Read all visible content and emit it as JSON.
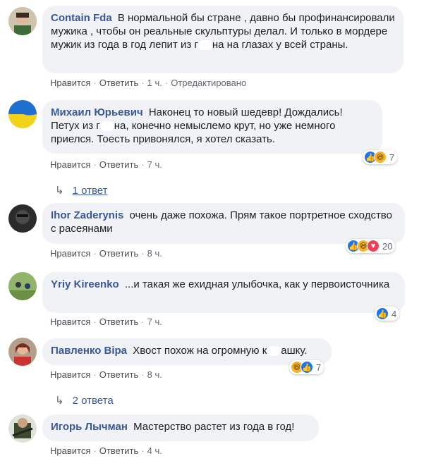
{
  "actions": {
    "like": "Нравится",
    "reply": "Ответить",
    "separator": "·"
  },
  "comments": [
    {
      "author": "Contain Fda",
      "text_before": "В нормальной бы стране , давно бы профинансировали мужика , чтобы он реальные скульптуры делал. И только в мордере мужик из года в год лепит из г",
      "text_after": "на на глазах у всей страны.",
      "time": "1 ч.",
      "edited": "Отредактировано"
    },
    {
      "author": "Михаил Юрьевич",
      "text_before": "Наконец то новый шедевр! Дождались! Петух из г",
      "text_after": "на, конечно немыслемо крут, но уже немного приелся. Тоесть привонялся, я хотел сказать.",
      "time": "7 ч.",
      "reaction_count": "7",
      "replies": "1 ответ"
    },
    {
      "author": "Ihor Zaderynis",
      "text": "очень даже похожа. Прям такое портретное сходство с расеянами",
      "time": "8 ч.",
      "reaction_count": "20"
    },
    {
      "author": "Yriy Kireenko",
      "text": "...и такая же ехидная улыбочка, как у первоисточника",
      "time": "7 ч.",
      "reaction_count": "4"
    },
    {
      "author": "Павленко Віра",
      "text_before": "Хвост похож на огромную к",
      "text_after": "ашку.",
      "time": "8 ч.",
      "reaction_count": "7",
      "replies": "2 ответа"
    },
    {
      "author": "Игорь Лычман",
      "text": "Мастерство растет из года в год!",
      "time": "4 ч."
    }
  ]
}
